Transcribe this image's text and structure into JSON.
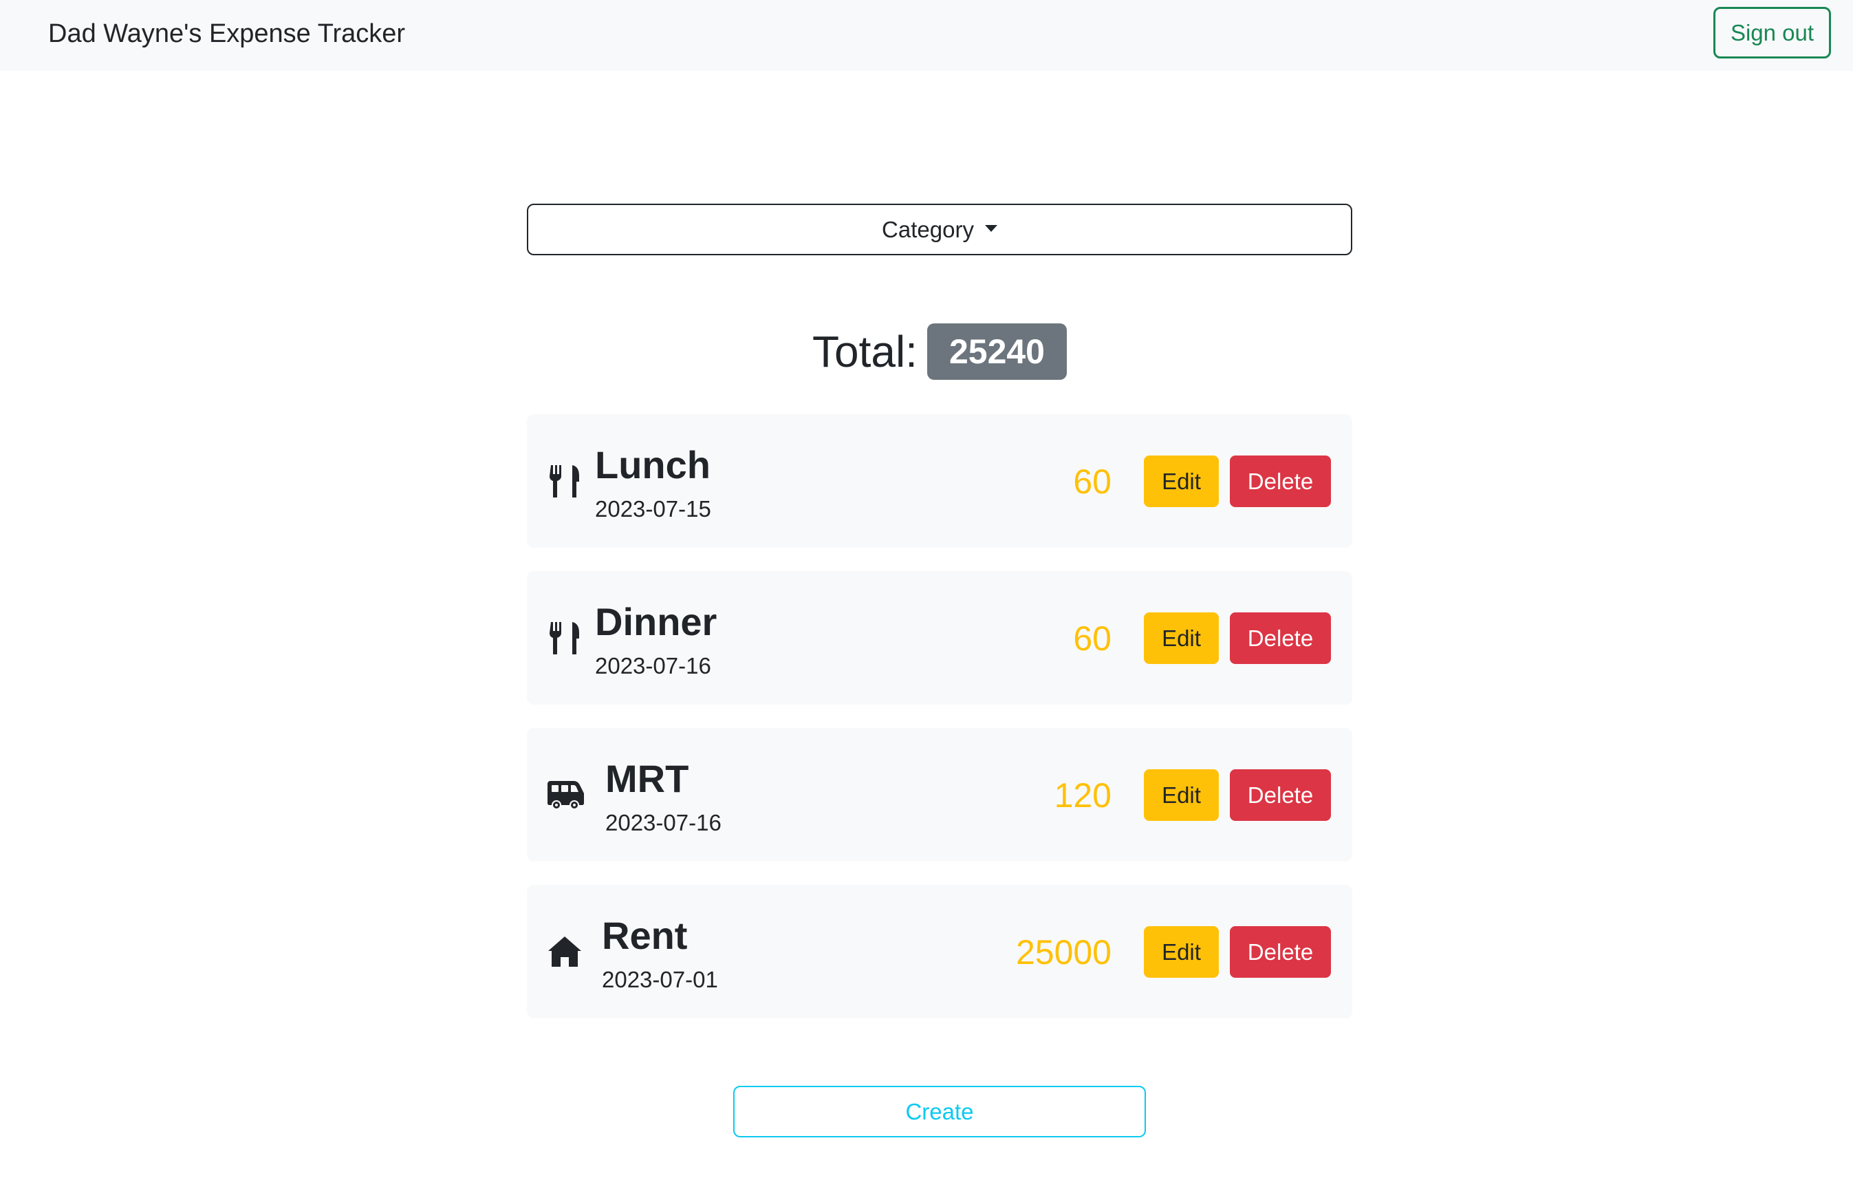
{
  "navbar": {
    "brand": "Dad Wayne's Expense Tracker",
    "signout_label": "Sign out"
  },
  "filter": {
    "category_label": "Category"
  },
  "summary": {
    "total_label": "Total:",
    "total_value": "25240"
  },
  "expenses": [
    {
      "icon": "utensils-icon",
      "title": "Lunch",
      "date": "2023-07-15",
      "amount": "60",
      "edit_label": "Edit",
      "delete_label": "Delete"
    },
    {
      "icon": "utensils-icon",
      "title": "Dinner",
      "date": "2023-07-16",
      "amount": "60",
      "edit_label": "Edit",
      "delete_label": "Delete"
    },
    {
      "icon": "van-icon",
      "title": "MRT",
      "date": "2023-07-16",
      "amount": "120",
      "edit_label": "Edit",
      "delete_label": "Delete"
    },
    {
      "icon": "house-icon",
      "title": "Rent",
      "date": "2023-07-01",
      "amount": "25000",
      "edit_label": "Edit",
      "delete_label": "Delete"
    }
  ],
  "actions": {
    "create_label": "Create"
  },
  "colors": {
    "amount": "#ffc107",
    "edit": "#ffc107",
    "delete": "#dc3545",
    "create": "#0dcaf0",
    "signout": "#198754",
    "badge": "#6c757d"
  }
}
